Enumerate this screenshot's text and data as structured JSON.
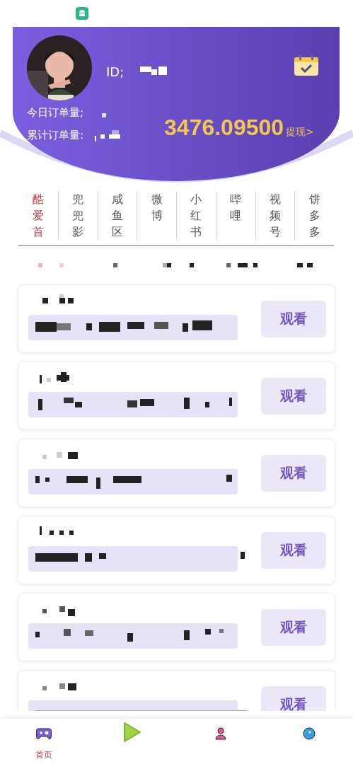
{
  "profile": {
    "id_label": "ID;",
    "today_orders_label": "今日订单量;",
    "total_orders_label": "累计订单量:",
    "balance": "3476.09500",
    "withdraw_link": "提现>"
  },
  "tabs": [
    {
      "label": "酷爱首",
      "selected": true
    },
    {
      "label": "兜兜影",
      "selected": false
    },
    {
      "label": "咸鱼区",
      "selected": false
    },
    {
      "label": "微博",
      "selected": false
    },
    {
      "label": "小红书",
      "selected": false
    },
    {
      "label": "哔哩",
      "selected": false
    },
    {
      "label": "视频号",
      "selected": false
    },
    {
      "label": "饼多多",
      "selected": false
    }
  ],
  "cards": [
    {
      "button": "观看"
    },
    {
      "button": "观看"
    },
    {
      "button": "观看"
    },
    {
      "button": "观看"
    },
    {
      "button": "观看"
    },
    {
      "button": "观看"
    }
  ],
  "bottom_nav": {
    "active_label": "首页"
  }
}
